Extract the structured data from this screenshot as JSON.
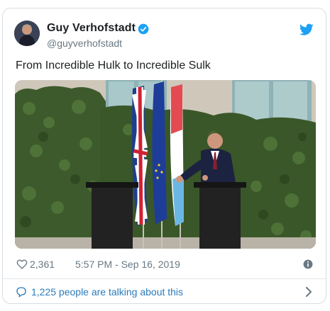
{
  "tweet": {
    "author_name": "Guy Verhofstadt",
    "author_handle": "@guyverhofstadt",
    "text": "From Incredible Hulk to Incredible Sulk",
    "likes": "2,361",
    "timestamp": "5:57 PM - Sep 16, 2019",
    "talking": "1,225 people are talking about this"
  },
  "icons": {
    "avatar": "avatar",
    "verified": "verified-badge-icon",
    "brand": "twitter-bird-icon",
    "like": "heart-icon",
    "info": "info-icon",
    "reply": "speech-bubble-icon",
    "chevron": "chevron-right-icon"
  },
  "colors": {
    "accent": "#1da1f2",
    "link": "#2b7bb9",
    "muted": "#697882"
  }
}
